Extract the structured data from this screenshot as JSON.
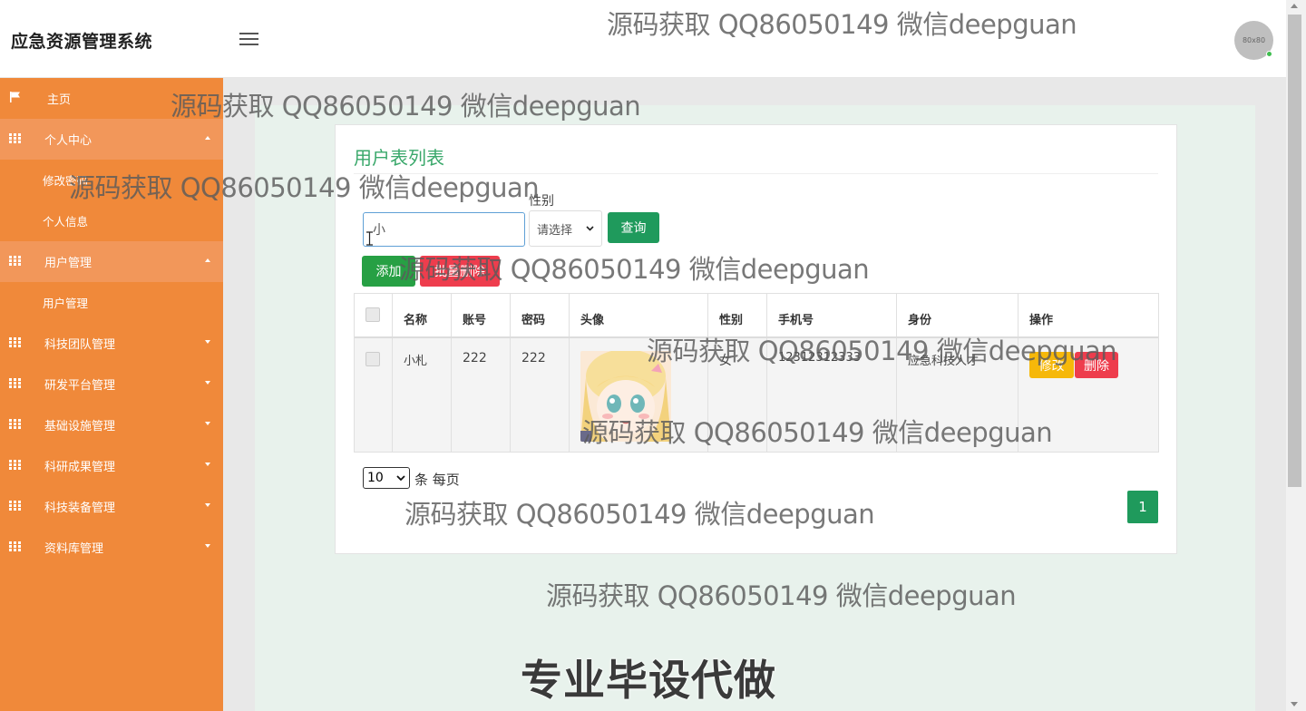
{
  "header": {
    "app_title": "应急资源管理系统",
    "avatar_text": "80x80"
  },
  "sidebar": {
    "home": "主页",
    "groups": [
      {
        "label": "个人中心",
        "expanded": true,
        "children": [
          "修改密码",
          "个人信息"
        ]
      },
      {
        "label": "用户管理",
        "expanded": true,
        "children": [
          "用户管理"
        ]
      },
      {
        "label": "科技团队管理",
        "expanded": false,
        "children": []
      },
      {
        "label": "研发平台管理",
        "expanded": false,
        "children": []
      },
      {
        "label": "基础设施管理",
        "expanded": false,
        "children": []
      },
      {
        "label": "科研成果管理",
        "expanded": false,
        "children": []
      },
      {
        "label": "科技装备管理",
        "expanded": false,
        "children": []
      },
      {
        "label": "资料库管理",
        "expanded": false,
        "children": []
      }
    ]
  },
  "card": {
    "title": "用户表列表",
    "search": {
      "value": "小",
      "gender_label": "性别",
      "gender_selected": "请选择",
      "search_button": "查询"
    },
    "actions": {
      "add": "添加",
      "batch_delete": "批量删除"
    },
    "table": {
      "columns": [
        "名称",
        "账号",
        "密码",
        "头像",
        "性别",
        "手机号",
        "身份",
        "操作"
      ],
      "rows": [
        {
          "name": "小札",
          "account": "222",
          "password": "222",
          "gender": "女",
          "phone": "12312312333",
          "identity": "应急科技人才",
          "edit": "修改",
          "delete": "删除"
        }
      ]
    },
    "pagination": {
      "page_size": "10",
      "page_size_label": "条 每页",
      "current_page": "1"
    }
  },
  "watermarks": {
    "text": "源码获取 QQ86050149 微信deepguan"
  },
  "promo": "专业毕设代做",
  "colors": {
    "sidebar": "#f0893a",
    "primary_green": "#1f9a5c",
    "danger": "#ee3d4d",
    "warning": "#f6b80a",
    "title_green": "#3aa86b"
  }
}
